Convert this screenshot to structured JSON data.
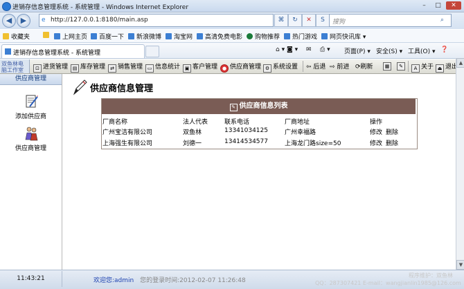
{
  "window": {
    "title": "进销存信息管理系统 - 系统管理 - Windows Internet Explorer",
    "btn_min": "–",
    "btn_max": "□",
    "btn_close": "✕"
  },
  "address": {
    "url": "http://127.0.0.1:8180/main.asp",
    "search_placeholder": "搜狗"
  },
  "favorites": {
    "label": "收藏夹",
    "items": [
      "上网主页",
      "百度一下",
      "新浪微博",
      "淘宝网",
      "高清免费电影",
      "购物推荐",
      "热门游戏",
      "网页快讯库"
    ]
  },
  "tab": {
    "label": "进销存信息管理系统 - 系统管理"
  },
  "ie_commands": {
    "page": "页面(P)",
    "safety": "安全(S)",
    "tools": "工具(O)"
  },
  "app_toolbar": {
    "logo_line1": "双鱼林电",
    "logo_line2": "脑工作室",
    "buttons": [
      "进货管理",
      "库存管理",
      "销售管理",
      "信息统计",
      "客户管理",
      "供应商管理",
      "系统设置",
      "后退",
      "前进",
      "刷新",
      "关于",
      "退出"
    ]
  },
  "sidebar": {
    "header": "供应商管理",
    "items": [
      {
        "label": "添加供应商",
        "icon": "add-document-icon"
      },
      {
        "label": "供应商管理",
        "icon": "people-icon"
      }
    ]
  },
  "main": {
    "title": "供应商信息管理",
    "list_title": "供应商信息列表",
    "columns": [
      "厂商名称",
      "法人代表",
      "联系电话",
      "厂商地址",
      "操作"
    ],
    "rows": [
      {
        "name": "广州宝洁有限公司",
        "rep": "双鱼林",
        "phone": "13341034125",
        "address": "广州幸福路",
        "edit": "修改",
        "delete": "删除"
      },
      {
        "name": "上海强生有限公司",
        "rep": "刘德一",
        "phone": "13414534577",
        "address": "上海龙门路size=50",
        "edit": "修改",
        "delete": "删除"
      }
    ]
  },
  "status": {
    "time": "11:43:21",
    "welcome_prefix": "欢迎您:",
    "user": "admin",
    "login_time": "您的登录时间:2012-02-07 11:26:48",
    "maintainer": "程序维护：双鱼林",
    "contact": "QQ：287307421 E-mail：wangjianlin1985@126.com"
  },
  "colors": {
    "list_header_bg": "#7a5c55",
    "welcome_blue": "#1a3fb0",
    "close_red": "#c4463a"
  }
}
